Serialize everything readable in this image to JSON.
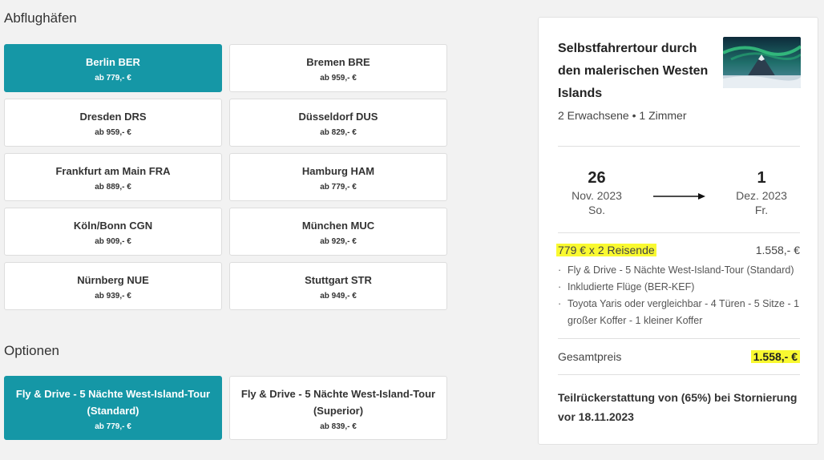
{
  "airports": {
    "title": "Abflughäfen",
    "items": [
      {
        "name": "Berlin BER",
        "price": "ab 779,- €",
        "selected": true
      },
      {
        "name": "Bremen BRE",
        "price": "ab 959,- €",
        "selected": false
      },
      {
        "name": "Dresden DRS",
        "price": "ab 959,- €",
        "selected": false
      },
      {
        "name": "Düsseldorf DUS",
        "price": "ab 829,- €",
        "selected": false
      },
      {
        "name": "Frankfurt am Main FRA",
        "price": "ab 889,- €",
        "selected": false
      },
      {
        "name": "Hamburg HAM",
        "price": "ab 779,- €",
        "selected": false
      },
      {
        "name": "Köln/Bonn CGN",
        "price": "ab 909,- €",
        "selected": false
      },
      {
        "name": "München MUC",
        "price": "ab 929,- €",
        "selected": false
      },
      {
        "name": "Nürnberg NUE",
        "price": "ab 939,- €",
        "selected": false
      },
      {
        "name": "Stuttgart STR",
        "price": "ab 949,- €",
        "selected": false
      }
    ]
  },
  "options": {
    "title": "Optionen",
    "items": [
      {
        "name": "Fly & Drive - 5 Nächte West-Island-Tour (Standard)",
        "price": "ab 779,- €",
        "selected": true
      },
      {
        "name": "Fly & Drive - 5 Nächte West-Island-Tour (Superior)",
        "price": "ab 839,- €",
        "selected": false
      }
    ]
  },
  "summary": {
    "title": "Selbstfahrertour durch den malerischen Westen Islands",
    "guests": "2 Erwachsene • 1 Zimmer",
    "date_from": {
      "day": "26",
      "month": "Nov. 2023",
      "weekday": "So."
    },
    "date_to": {
      "day": "1",
      "month": "Dez. 2023",
      "weekday": "Fr."
    },
    "price_calc": "779 € x 2 Reisende",
    "price_subtotal": "1.558,- €",
    "details": [
      "Fly & Drive - 5 Nächte West-Island-Tour (Standard)",
      "Inkludierte Flüge (BER-KEF)",
      "Toyota Yaris oder vergleichbar - 4 Türen - 5 Sitze - 1 großer Koffer - 1 kleiner Koffer"
    ],
    "total_label": "Gesamtpreis",
    "total_value": "1.558,- €",
    "refund": "Teilrückerstattung von (65%) bei Stornierung vor 18.11.2023",
    "highlight_color": "#f9f930",
    "accent_color": "#1597a6"
  }
}
